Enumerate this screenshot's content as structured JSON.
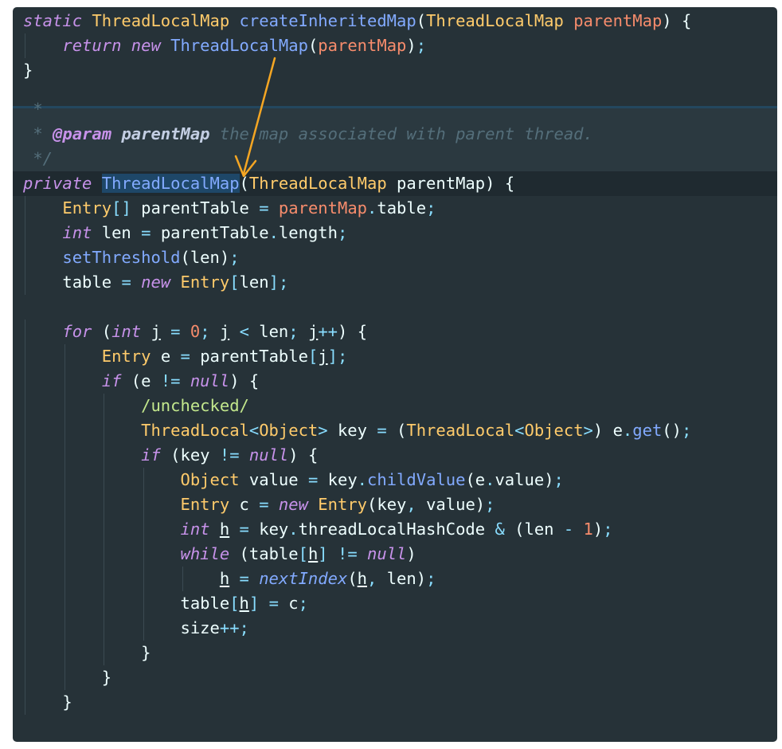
{
  "editor": {
    "lines": [
      "static ThreadLocalMap createInheritedMap(ThreadLocalMap parentMap) {",
      "    return new ThreadLocalMap(parentMap);",
      "}",
      "",
      " *",
      " * @param parentMap the map associated with parent thread.",
      " */",
      "private ThreadLocalMap(ThreadLocalMap parentMap) {",
      "    Entry[] parentTable = parentMap.table;",
      "    int len = parentTable.length;",
      "    setThreshold(len);",
      "    table = new Entry[len];",
      "",
      "    for (int j = 0; j < len; j++) {",
      "        Entry e = parentTable[j];",
      "        if (e != null) {",
      "            /unchecked/",
      "            ThreadLocal<Object> key = (ThreadLocal<Object>) e.get();",
      "            if (key != null) {",
      "                Object value = key.childValue(e.value);",
      "                Entry c = new Entry(key, value);",
      "                int h = key.threadLocalHashCode & (len - 1);",
      "                while (table[h] != null)",
      "                    h = nextIndex(h, len);",
      "                table[h] = c;",
      "                size++;",
      "            }",
      "        }",
      "    }"
    ]
  },
  "colors": {
    "background": "#263238",
    "keyword": "#c792ea",
    "type": "#ffcb6b",
    "function": "#82aaff",
    "operator": "#89ddff",
    "number": "#f78c6c",
    "comment": "#546e7a",
    "annotation_arrow": "#f5a623",
    "selection": "#1e4768"
  }
}
